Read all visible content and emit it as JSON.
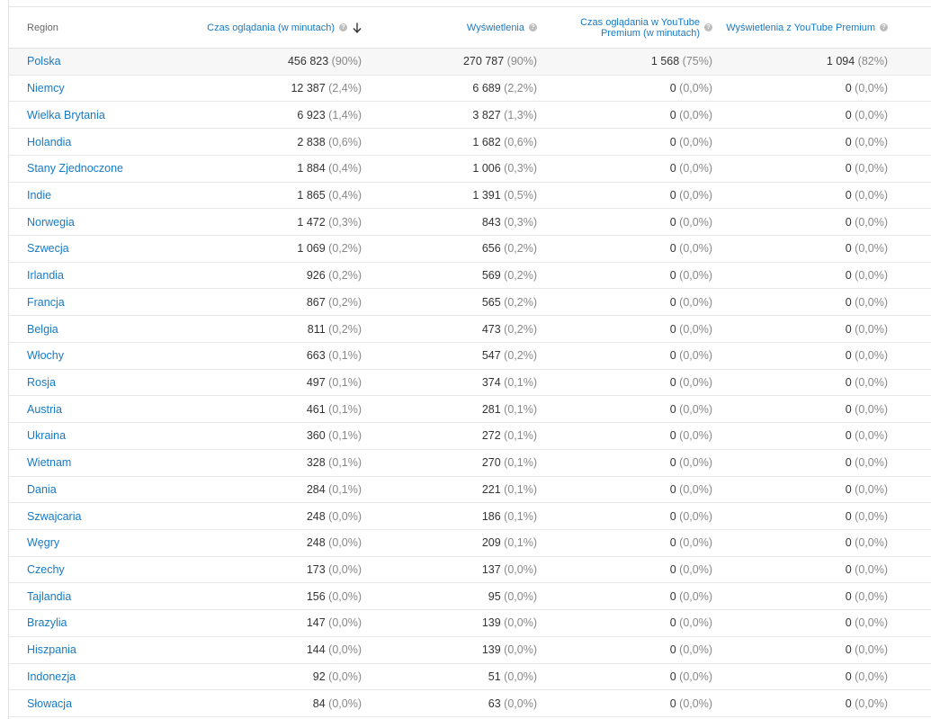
{
  "headers": {
    "region": "Region",
    "watch_time": "Czas oglądania (w minutach)",
    "views": "Wyświetlenia",
    "premium_watch_time_line1": "Czas oglądania w YouTube",
    "premium_watch_time_line2": "Premium (w minutach)",
    "premium_views": "Wyświetlenia z YouTube Premium",
    "help_glyph": "?",
    "sort_icon": "arrow-down-icon"
  },
  "colors": {
    "link": "#167ac6",
    "muted": "#888888",
    "text": "#333333",
    "header": "#666666"
  },
  "rows": [
    {
      "region": "Polska",
      "wt": "456 823",
      "wt_pct": "(90%)",
      "views": "270 787",
      "views_pct": "(90%)",
      "pwt": "1 568",
      "pwt_pct": "(75%)",
      "pv": "1 094",
      "pv_pct": "(82%)"
    },
    {
      "region": "Niemcy",
      "wt": "12 387",
      "wt_pct": "(2,4%)",
      "views": "6 689",
      "views_pct": "(2,2%)",
      "pwt": "0",
      "pwt_pct": "(0,0%)",
      "pv": "0",
      "pv_pct": "(0,0%)"
    },
    {
      "region": "Wielka Brytania",
      "wt": "6 923",
      "wt_pct": "(1,4%)",
      "views": "3 827",
      "views_pct": "(1,3%)",
      "pwt": "0",
      "pwt_pct": "(0,0%)",
      "pv": "0",
      "pv_pct": "(0,0%)"
    },
    {
      "region": "Holandia",
      "wt": "2 838",
      "wt_pct": "(0,6%)",
      "views": "1 682",
      "views_pct": "(0,6%)",
      "pwt": "0",
      "pwt_pct": "(0,0%)",
      "pv": "0",
      "pv_pct": "(0,0%)"
    },
    {
      "region": "Stany Zjednoczone",
      "wt": "1 884",
      "wt_pct": "(0,4%)",
      "views": "1 006",
      "views_pct": "(0,3%)",
      "pwt": "0",
      "pwt_pct": "(0,0%)",
      "pv": "0",
      "pv_pct": "(0,0%)"
    },
    {
      "region": "Indie",
      "wt": "1 865",
      "wt_pct": "(0,4%)",
      "views": "1 391",
      "views_pct": "(0,5%)",
      "pwt": "0",
      "pwt_pct": "(0,0%)",
      "pv": "0",
      "pv_pct": "(0,0%)"
    },
    {
      "region": "Norwegia",
      "wt": "1 472",
      "wt_pct": "(0,3%)",
      "views": "843",
      "views_pct": "(0,3%)",
      "pwt": "0",
      "pwt_pct": "(0,0%)",
      "pv": "0",
      "pv_pct": "(0,0%)"
    },
    {
      "region": "Szwecja",
      "wt": "1 069",
      "wt_pct": "(0,2%)",
      "views": "656",
      "views_pct": "(0,2%)",
      "pwt": "0",
      "pwt_pct": "(0,0%)",
      "pv": "0",
      "pv_pct": "(0,0%)"
    },
    {
      "region": "Irlandia",
      "wt": "926",
      "wt_pct": "(0,2%)",
      "views": "569",
      "views_pct": "(0,2%)",
      "pwt": "0",
      "pwt_pct": "(0,0%)",
      "pv": "0",
      "pv_pct": "(0,0%)"
    },
    {
      "region": "Francja",
      "wt": "867",
      "wt_pct": "(0,2%)",
      "views": "565",
      "views_pct": "(0,2%)",
      "pwt": "0",
      "pwt_pct": "(0,0%)",
      "pv": "0",
      "pv_pct": "(0,0%)"
    },
    {
      "region": "Belgia",
      "wt": "811",
      "wt_pct": "(0,2%)",
      "views": "473",
      "views_pct": "(0,2%)",
      "pwt": "0",
      "pwt_pct": "(0,0%)",
      "pv": "0",
      "pv_pct": "(0,0%)"
    },
    {
      "region": "Włochy",
      "wt": "663",
      "wt_pct": "(0,1%)",
      "views": "547",
      "views_pct": "(0,2%)",
      "pwt": "0",
      "pwt_pct": "(0,0%)",
      "pv": "0",
      "pv_pct": "(0,0%)"
    },
    {
      "region": "Rosja",
      "wt": "497",
      "wt_pct": "(0,1%)",
      "views": "374",
      "views_pct": "(0,1%)",
      "pwt": "0",
      "pwt_pct": "(0,0%)",
      "pv": "0",
      "pv_pct": "(0,0%)"
    },
    {
      "region": "Austria",
      "wt": "461",
      "wt_pct": "(0,1%)",
      "views": "281",
      "views_pct": "(0,1%)",
      "pwt": "0",
      "pwt_pct": "(0,0%)",
      "pv": "0",
      "pv_pct": "(0,0%)"
    },
    {
      "region": "Ukraina",
      "wt": "360",
      "wt_pct": "(0,1%)",
      "views": "272",
      "views_pct": "(0,1%)",
      "pwt": "0",
      "pwt_pct": "(0,0%)",
      "pv": "0",
      "pv_pct": "(0,0%)"
    },
    {
      "region": "Wietnam",
      "wt": "328",
      "wt_pct": "(0,1%)",
      "views": "270",
      "views_pct": "(0,1%)",
      "pwt": "0",
      "pwt_pct": "(0,0%)",
      "pv": "0",
      "pv_pct": "(0,0%)"
    },
    {
      "region": "Dania",
      "wt": "284",
      "wt_pct": "(0,1%)",
      "views": "221",
      "views_pct": "(0,1%)",
      "pwt": "0",
      "pwt_pct": "(0,0%)",
      "pv": "0",
      "pv_pct": "(0,0%)"
    },
    {
      "region": "Szwajcaria",
      "wt": "248",
      "wt_pct": "(0,0%)",
      "views": "186",
      "views_pct": "(0,1%)",
      "pwt": "0",
      "pwt_pct": "(0,0%)",
      "pv": "0",
      "pv_pct": "(0,0%)"
    },
    {
      "region": "Węgry",
      "wt": "248",
      "wt_pct": "(0,0%)",
      "views": "209",
      "views_pct": "(0,1%)",
      "pwt": "0",
      "pwt_pct": "(0,0%)",
      "pv": "0",
      "pv_pct": "(0,0%)"
    },
    {
      "region": "Czechy",
      "wt": "173",
      "wt_pct": "(0,0%)",
      "views": "137",
      "views_pct": "(0,0%)",
      "pwt": "0",
      "pwt_pct": "(0,0%)",
      "pv": "0",
      "pv_pct": "(0,0%)"
    },
    {
      "region": "Tajlandia",
      "wt": "156",
      "wt_pct": "(0,0%)",
      "views": "95",
      "views_pct": "(0,0%)",
      "pwt": "0",
      "pwt_pct": "(0,0%)",
      "pv": "0",
      "pv_pct": "(0,0%)"
    },
    {
      "region": "Brazylia",
      "wt": "147",
      "wt_pct": "(0,0%)",
      "views": "139",
      "views_pct": "(0,0%)",
      "pwt": "0",
      "pwt_pct": "(0,0%)",
      "pv": "0",
      "pv_pct": "(0,0%)"
    },
    {
      "region": "Hiszpania",
      "wt": "144",
      "wt_pct": "(0,0%)",
      "views": "139",
      "views_pct": "(0,0%)",
      "pwt": "0",
      "pwt_pct": "(0,0%)",
      "pv": "0",
      "pv_pct": "(0,0%)"
    },
    {
      "region": "Indonezja",
      "wt": "92",
      "wt_pct": "(0,0%)",
      "views": "51",
      "views_pct": "(0,0%)",
      "pwt": "0",
      "pwt_pct": "(0,0%)",
      "pv": "0",
      "pv_pct": "(0,0%)"
    },
    {
      "region": "Słowacja",
      "wt": "84",
      "wt_pct": "(0,0%)",
      "views": "63",
      "views_pct": "(0,0%)",
      "pwt": "0",
      "pwt_pct": "(0,0%)",
      "pv": "0",
      "pv_pct": "(0,0%)"
    }
  ]
}
